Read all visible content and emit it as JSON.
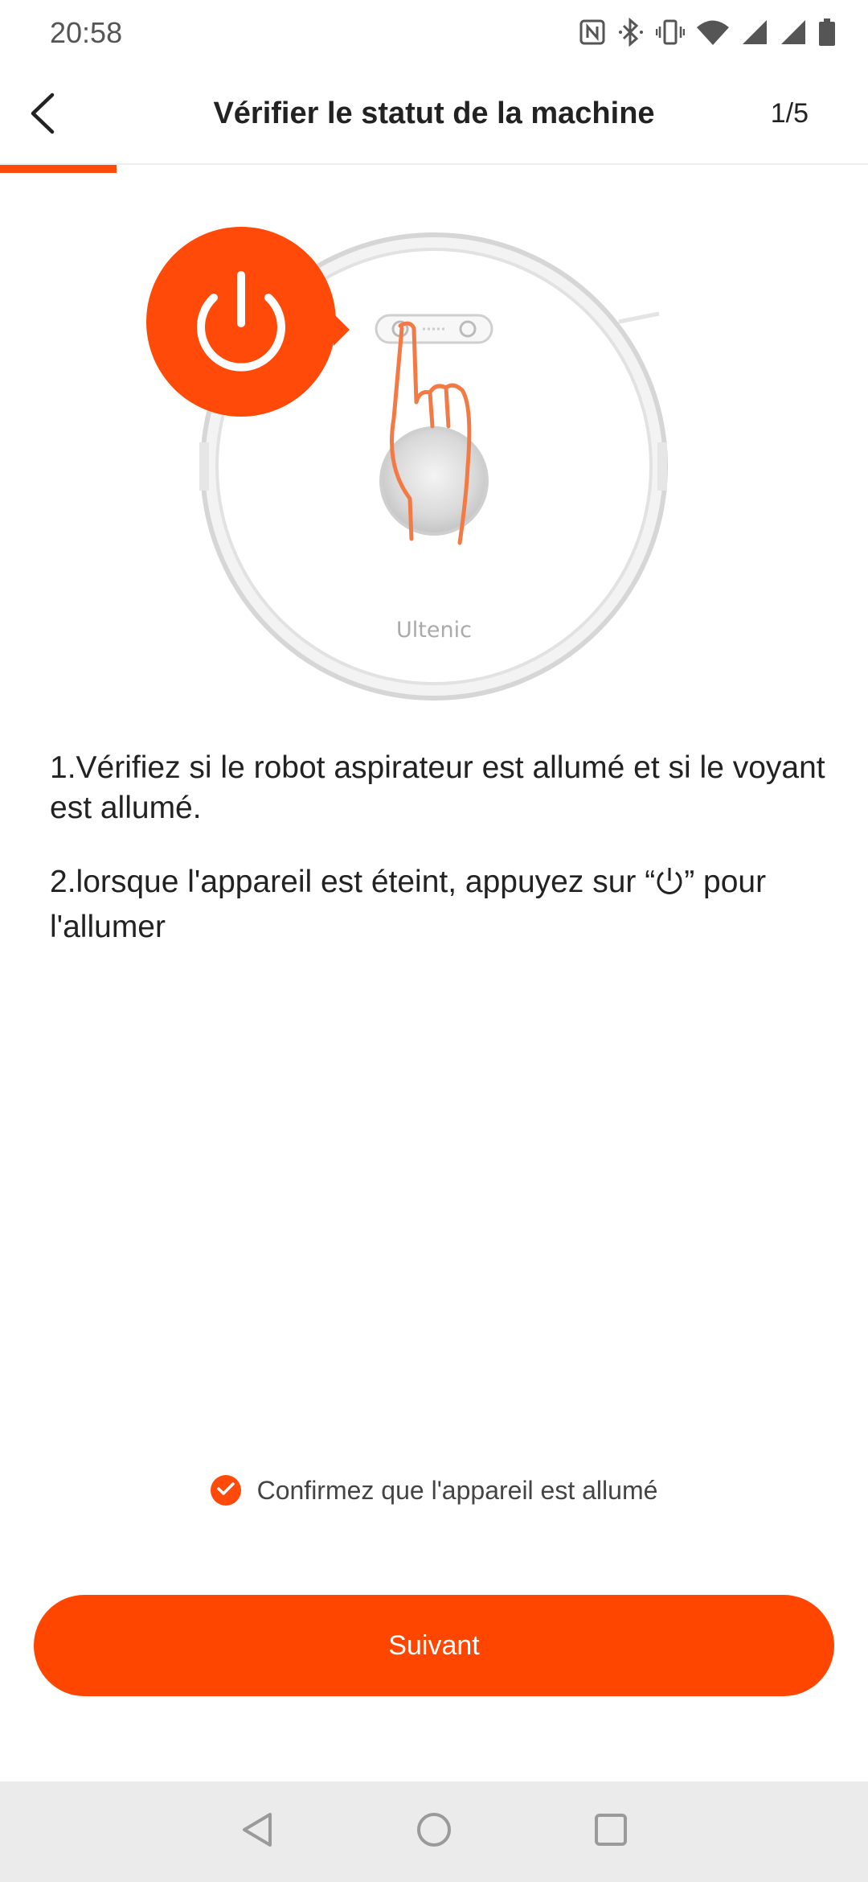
{
  "status_bar": {
    "time": "20:58",
    "icons": [
      "nfc-icon",
      "bluetooth-icon",
      "vibrate-icon",
      "wifi-icon",
      "signal-icon",
      "signal-icon",
      "battery-icon"
    ]
  },
  "header": {
    "title": "Vérifier le statut de la machine",
    "step": "1/5",
    "back_icon": "chevron-left-icon"
  },
  "progress": {
    "current_step": 1,
    "total_steps": 5,
    "fraction": 0.2,
    "color": "#ff4a0a"
  },
  "illustration": {
    "brand_logo": "Ultenic",
    "icons": [
      "power-icon",
      "robot-vacuum-icon",
      "pointing-hand-icon"
    ]
  },
  "instructions": {
    "step1": "1.Vérifiez si le robot aspirateur est allumé et si le voyant est allumé.",
    "step2_before": "2.lorsque l'appareil est éteint, appuyez sur “",
    "step2_after": "” pour l'allumer"
  },
  "confirm": {
    "label": "Confirmez que l'appareil est allumé",
    "checked": true
  },
  "next_button": {
    "label": "Suivant"
  },
  "nav": {
    "icons": [
      "back-triangle-icon",
      "home-circle-icon",
      "recents-square-icon"
    ]
  },
  "colors": {
    "accent": "#ff4a0a",
    "button": "#ff4600",
    "nav_bg": "#ebebeb"
  }
}
